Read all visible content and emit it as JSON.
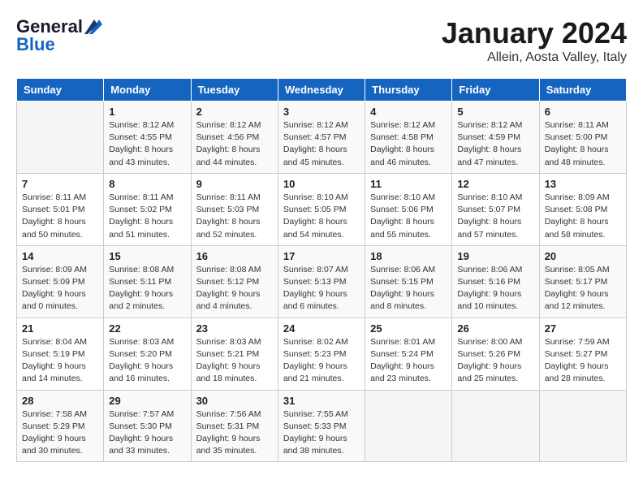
{
  "header": {
    "logo_general": "General",
    "logo_blue": "Blue",
    "title": "January 2024",
    "subtitle": "Allein, Aosta Valley, Italy"
  },
  "weekdays": [
    "Sunday",
    "Monday",
    "Tuesday",
    "Wednesday",
    "Thursday",
    "Friday",
    "Saturday"
  ],
  "weeks": [
    [
      {
        "day": "",
        "sunrise": "",
        "sunset": "",
        "daylight": ""
      },
      {
        "day": "1",
        "sunrise": "Sunrise: 8:12 AM",
        "sunset": "Sunset: 4:55 PM",
        "daylight": "Daylight: 8 hours and 43 minutes."
      },
      {
        "day": "2",
        "sunrise": "Sunrise: 8:12 AM",
        "sunset": "Sunset: 4:56 PM",
        "daylight": "Daylight: 8 hours and 44 minutes."
      },
      {
        "day": "3",
        "sunrise": "Sunrise: 8:12 AM",
        "sunset": "Sunset: 4:57 PM",
        "daylight": "Daylight: 8 hours and 45 minutes."
      },
      {
        "day": "4",
        "sunrise": "Sunrise: 8:12 AM",
        "sunset": "Sunset: 4:58 PM",
        "daylight": "Daylight: 8 hours and 46 minutes."
      },
      {
        "day": "5",
        "sunrise": "Sunrise: 8:12 AM",
        "sunset": "Sunset: 4:59 PM",
        "daylight": "Daylight: 8 hours and 47 minutes."
      },
      {
        "day": "6",
        "sunrise": "Sunrise: 8:11 AM",
        "sunset": "Sunset: 5:00 PM",
        "daylight": "Daylight: 8 hours and 48 minutes."
      }
    ],
    [
      {
        "day": "7",
        "sunrise": "Sunrise: 8:11 AM",
        "sunset": "Sunset: 5:01 PM",
        "daylight": "Daylight: 8 hours and 50 minutes."
      },
      {
        "day": "8",
        "sunrise": "Sunrise: 8:11 AM",
        "sunset": "Sunset: 5:02 PM",
        "daylight": "Daylight: 8 hours and 51 minutes."
      },
      {
        "day": "9",
        "sunrise": "Sunrise: 8:11 AM",
        "sunset": "Sunset: 5:03 PM",
        "daylight": "Daylight: 8 hours and 52 minutes."
      },
      {
        "day": "10",
        "sunrise": "Sunrise: 8:10 AM",
        "sunset": "Sunset: 5:05 PM",
        "daylight": "Daylight: 8 hours and 54 minutes."
      },
      {
        "day": "11",
        "sunrise": "Sunrise: 8:10 AM",
        "sunset": "Sunset: 5:06 PM",
        "daylight": "Daylight: 8 hours and 55 minutes."
      },
      {
        "day": "12",
        "sunrise": "Sunrise: 8:10 AM",
        "sunset": "Sunset: 5:07 PM",
        "daylight": "Daylight: 8 hours and 57 minutes."
      },
      {
        "day": "13",
        "sunrise": "Sunrise: 8:09 AM",
        "sunset": "Sunset: 5:08 PM",
        "daylight": "Daylight: 8 hours and 58 minutes."
      }
    ],
    [
      {
        "day": "14",
        "sunrise": "Sunrise: 8:09 AM",
        "sunset": "Sunset: 5:09 PM",
        "daylight": "Daylight: 9 hours and 0 minutes."
      },
      {
        "day": "15",
        "sunrise": "Sunrise: 8:08 AM",
        "sunset": "Sunset: 5:11 PM",
        "daylight": "Daylight: 9 hours and 2 minutes."
      },
      {
        "day": "16",
        "sunrise": "Sunrise: 8:08 AM",
        "sunset": "Sunset: 5:12 PM",
        "daylight": "Daylight: 9 hours and 4 minutes."
      },
      {
        "day": "17",
        "sunrise": "Sunrise: 8:07 AM",
        "sunset": "Sunset: 5:13 PM",
        "daylight": "Daylight: 9 hours and 6 minutes."
      },
      {
        "day": "18",
        "sunrise": "Sunrise: 8:06 AM",
        "sunset": "Sunset: 5:15 PM",
        "daylight": "Daylight: 9 hours and 8 minutes."
      },
      {
        "day": "19",
        "sunrise": "Sunrise: 8:06 AM",
        "sunset": "Sunset: 5:16 PM",
        "daylight": "Daylight: 9 hours and 10 minutes."
      },
      {
        "day": "20",
        "sunrise": "Sunrise: 8:05 AM",
        "sunset": "Sunset: 5:17 PM",
        "daylight": "Daylight: 9 hours and 12 minutes."
      }
    ],
    [
      {
        "day": "21",
        "sunrise": "Sunrise: 8:04 AM",
        "sunset": "Sunset: 5:19 PM",
        "daylight": "Daylight: 9 hours and 14 minutes."
      },
      {
        "day": "22",
        "sunrise": "Sunrise: 8:03 AM",
        "sunset": "Sunset: 5:20 PM",
        "daylight": "Daylight: 9 hours and 16 minutes."
      },
      {
        "day": "23",
        "sunrise": "Sunrise: 8:03 AM",
        "sunset": "Sunset: 5:21 PM",
        "daylight": "Daylight: 9 hours and 18 minutes."
      },
      {
        "day": "24",
        "sunrise": "Sunrise: 8:02 AM",
        "sunset": "Sunset: 5:23 PM",
        "daylight": "Daylight: 9 hours and 21 minutes."
      },
      {
        "day": "25",
        "sunrise": "Sunrise: 8:01 AM",
        "sunset": "Sunset: 5:24 PM",
        "daylight": "Daylight: 9 hours and 23 minutes."
      },
      {
        "day": "26",
        "sunrise": "Sunrise: 8:00 AM",
        "sunset": "Sunset: 5:26 PM",
        "daylight": "Daylight: 9 hours and 25 minutes."
      },
      {
        "day": "27",
        "sunrise": "Sunrise: 7:59 AM",
        "sunset": "Sunset: 5:27 PM",
        "daylight": "Daylight: 9 hours and 28 minutes."
      }
    ],
    [
      {
        "day": "28",
        "sunrise": "Sunrise: 7:58 AM",
        "sunset": "Sunset: 5:29 PM",
        "daylight": "Daylight: 9 hours and 30 minutes."
      },
      {
        "day": "29",
        "sunrise": "Sunrise: 7:57 AM",
        "sunset": "Sunset: 5:30 PM",
        "daylight": "Daylight: 9 hours and 33 minutes."
      },
      {
        "day": "30",
        "sunrise": "Sunrise: 7:56 AM",
        "sunset": "Sunset: 5:31 PM",
        "daylight": "Daylight: 9 hours and 35 minutes."
      },
      {
        "day": "31",
        "sunrise": "Sunrise: 7:55 AM",
        "sunset": "Sunset: 5:33 PM",
        "daylight": "Daylight: 9 hours and 38 minutes."
      },
      {
        "day": "",
        "sunrise": "",
        "sunset": "",
        "daylight": ""
      },
      {
        "day": "",
        "sunrise": "",
        "sunset": "",
        "daylight": ""
      },
      {
        "day": "",
        "sunrise": "",
        "sunset": "",
        "daylight": ""
      }
    ]
  ]
}
